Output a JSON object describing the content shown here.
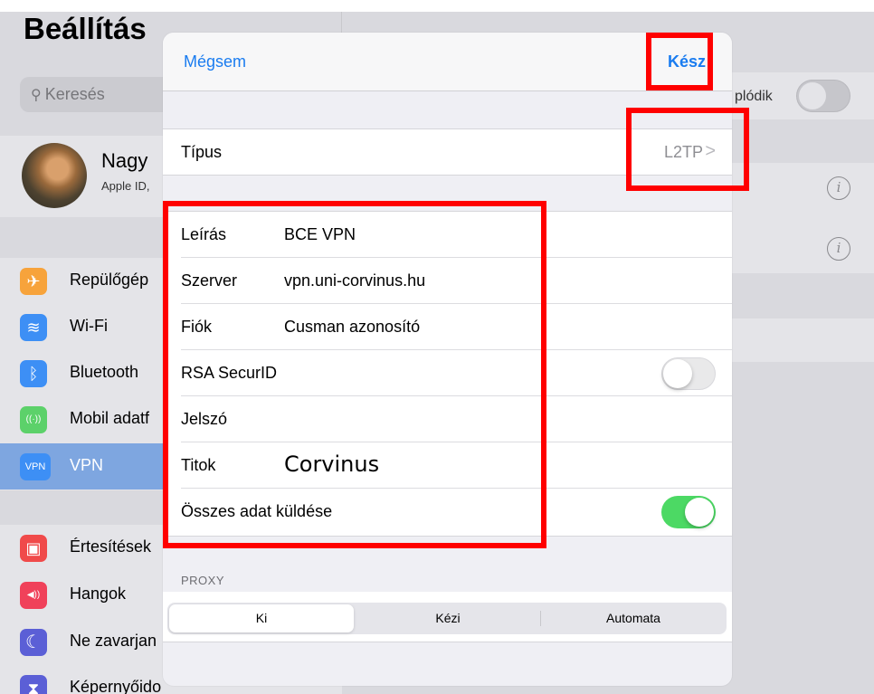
{
  "sidebar": {
    "title": "Beállítás",
    "search_placeholder": "Keresés",
    "profile": {
      "name": "Nagy",
      "subtitle": "Apple ID,"
    },
    "items": [
      {
        "label": "Repülőgép",
        "color": "#f7a33b",
        "icon": "airplane-icon",
        "glyph": "✈"
      },
      {
        "label": "Wi-Fi",
        "color": "#3d8ff5",
        "icon": "wifi-icon",
        "glyph": "≋"
      },
      {
        "label": "Bluetooth",
        "color": "#3d8ff5",
        "icon": "bluetooth-icon",
        "glyph": "ᛒ"
      },
      {
        "label": "Mobil adatf",
        "color": "#5cd16a",
        "icon": "cellular-icon",
        "glyph": "((·))"
      },
      {
        "label": "VPN",
        "color": "#3d8ff5",
        "icon": "vpn-icon",
        "glyph": "VPN"
      },
      {
        "label": "Értesítések",
        "color": "#f04a4a",
        "icon": "notifications-icon",
        "glyph": "▣"
      },
      {
        "label": "Hangok",
        "color": "#f0415a",
        "icon": "sounds-icon",
        "glyph": "◀))"
      },
      {
        "label": "Ne zavarjan",
        "color": "#5b5fd6",
        "icon": "moon-icon",
        "glyph": "☾"
      },
      {
        "label": "Képernyőido",
        "color": "#5b5fd6",
        "icon": "hourglass-icon",
        "glyph": "⧗"
      }
    ]
  },
  "background": {
    "toggle_label": "plódik",
    "info_glyph": "i"
  },
  "modal": {
    "cancel_label": "Mégsem",
    "done_label": "Kész",
    "type_row": {
      "key": "Típus",
      "value": "L2TP",
      "chevron": ">"
    },
    "fields": [
      {
        "key": "Leírás",
        "value": "BCE VPN"
      },
      {
        "key": "Szerver",
        "value": "vpn.uni-corvinus.hu"
      },
      {
        "key": "Fiók",
        "value": "Cusman azonosító"
      },
      {
        "key": "RSA SecurID",
        "toggle": false
      },
      {
        "key": "Jelszó",
        "value": ""
      },
      {
        "key": "Titok",
        "value": "Corvinus"
      },
      {
        "key": "Összes adat küldése",
        "toggle": true
      }
    ],
    "proxy": {
      "label": "PROXY",
      "options": [
        "Ki",
        "Kézi",
        "Automata"
      ],
      "selected": "Ki"
    }
  },
  "colors": {
    "accent": "#1a7cf0",
    "toggle_on": "#4cd964",
    "highlight": "#ff0000"
  }
}
